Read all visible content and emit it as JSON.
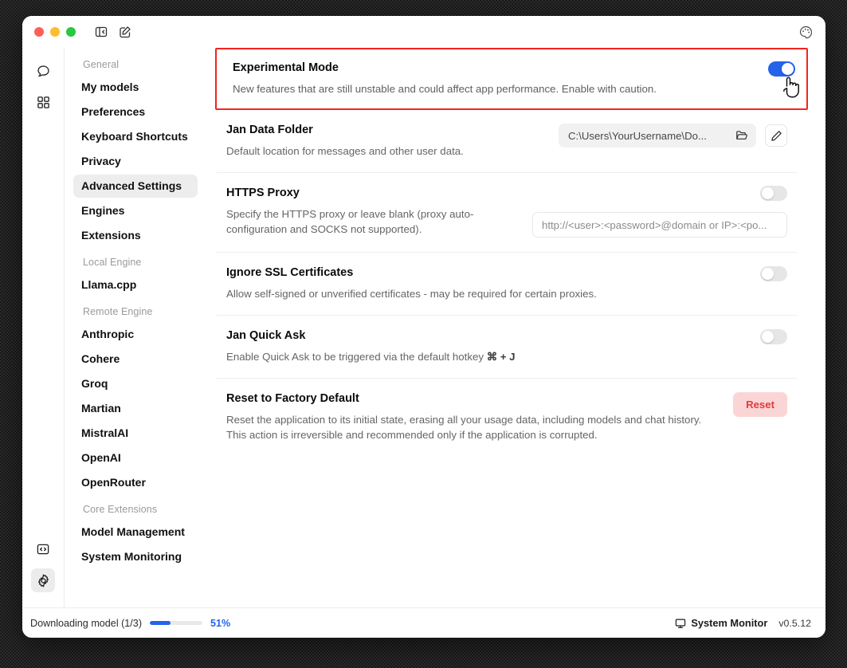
{
  "window": {
    "traffic_lights": [
      "close",
      "minimize",
      "maximize"
    ],
    "toolbar_icons": [
      "panel-collapse-icon",
      "compose-icon"
    ],
    "theme_icon": "palette-icon"
  },
  "rail": {
    "items": [
      {
        "icon": "chat-bubble-icon",
        "active": false
      },
      {
        "icon": "grid-apps-icon",
        "active": false
      }
    ],
    "bottom_items": [
      {
        "icon": "code-brackets-icon",
        "active": false
      },
      {
        "icon": "gear-icon",
        "active": true
      }
    ]
  },
  "sidebar": {
    "groups": [
      {
        "label": "General",
        "items": [
          {
            "label": "My models",
            "active": false
          },
          {
            "label": "Preferences",
            "active": false
          },
          {
            "label": "Keyboard Shortcuts",
            "active": false
          },
          {
            "label": "Privacy",
            "active": false
          },
          {
            "label": "Advanced Settings",
            "active": true
          },
          {
            "label": "Engines",
            "active": false
          },
          {
            "label": "Extensions",
            "active": false
          }
        ]
      },
      {
        "label": "Local Engine",
        "items": [
          {
            "label": "Llama.cpp",
            "active": false
          }
        ]
      },
      {
        "label": "Remote Engine",
        "items": [
          {
            "label": "Anthropic",
            "active": false
          },
          {
            "label": "Cohere",
            "active": false
          },
          {
            "label": "Groq",
            "active": false
          },
          {
            "label": "Martian",
            "active": false
          },
          {
            "label": "MistralAI",
            "active": false
          },
          {
            "label": "OpenAI",
            "active": false
          },
          {
            "label": "OpenRouter",
            "active": false
          }
        ]
      },
      {
        "label": "Core Extensions",
        "items": [
          {
            "label": "Model Management",
            "active": false
          },
          {
            "label": "System Monitoring",
            "active": false
          }
        ]
      }
    ]
  },
  "settings": {
    "experimental": {
      "title": "Experimental Mode",
      "description": "New features that are still unstable and could affect app performance. Enable with caution.",
      "toggle_state": "on",
      "highlight_color": "#f5241d",
      "cursor": "pointing-hand-cursor"
    },
    "data_folder": {
      "title": "Jan Data Folder",
      "description": "Default location for messages and other user data.",
      "path_value": "C:\\Users\\YourUsername\\Do...",
      "open_folder_icon": "folder-open-icon",
      "edit_icon": "pencil-edit-icon"
    },
    "https_proxy": {
      "title": "HTTPS Proxy",
      "description": "Specify the HTTPS proxy or leave blank (proxy auto-configuration and SOCKS not supported).",
      "toggle_state": "off",
      "input_placeholder": "http://<user>:<password>@domain or IP>:<po..."
    },
    "ignore_ssl": {
      "title": "Ignore SSL Certificates",
      "description": "Allow self-signed or unverified certificates - may be required for certain proxies.",
      "toggle_state": "off"
    },
    "quick_ask": {
      "title": "Jan Quick Ask",
      "description_prefix": "Enable Quick Ask to be triggered via the default hotkey ",
      "hotkey": "⌘ + J",
      "toggle_state": "off"
    },
    "factory_reset": {
      "title": "Reset to Factory Default",
      "description": "Reset the application to its initial state, erasing all your usage data, including models and chat history. This action is irreversible and recommended only if the application is corrupted.",
      "button_label": "Reset",
      "button_color": "#e23b3b"
    }
  },
  "statusbar": {
    "download_label": "Downloading model (1/3)",
    "progress_percent": "51%",
    "progress_fill_width": "40%",
    "system_monitor_label": "System Monitor",
    "system_monitor_icon": "monitor-icon",
    "version": "v0.5.12",
    "accent_color": "#2563eb"
  }
}
